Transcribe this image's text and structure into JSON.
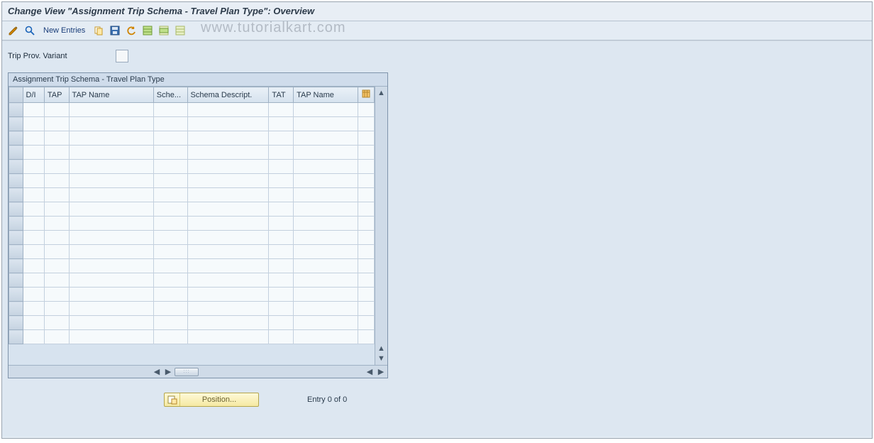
{
  "header": {
    "title": "Change View \"Assignment Trip Schema - Travel Plan Type\": Overview"
  },
  "toolbar": {
    "new_entries_label": "New Entries",
    "icons": {
      "glasses": "change-display-toggle",
      "find": "find",
      "copy": "copy-as",
      "save": "save",
      "undo": "undo-change",
      "select_all": "select-all",
      "select_block": "select-block",
      "deselect": "deselect-all"
    }
  },
  "watermark": "www.tutorialkart.com",
  "form": {
    "trip_prov_variant_label": "Trip Prov. Variant",
    "trip_prov_variant_value": ""
  },
  "panel": {
    "title": "Assignment Trip Schema - Travel Plan Type",
    "columns": [
      "D/I",
      "TAP",
      "TAP Name",
      "Sche...",
      "Schema Descript.",
      "TAT",
      "TAP Name"
    ],
    "config_icon": "table-settings",
    "row_count": 17
  },
  "footer": {
    "position_label": "Position...",
    "entry_text": "Entry 0 of 0"
  }
}
